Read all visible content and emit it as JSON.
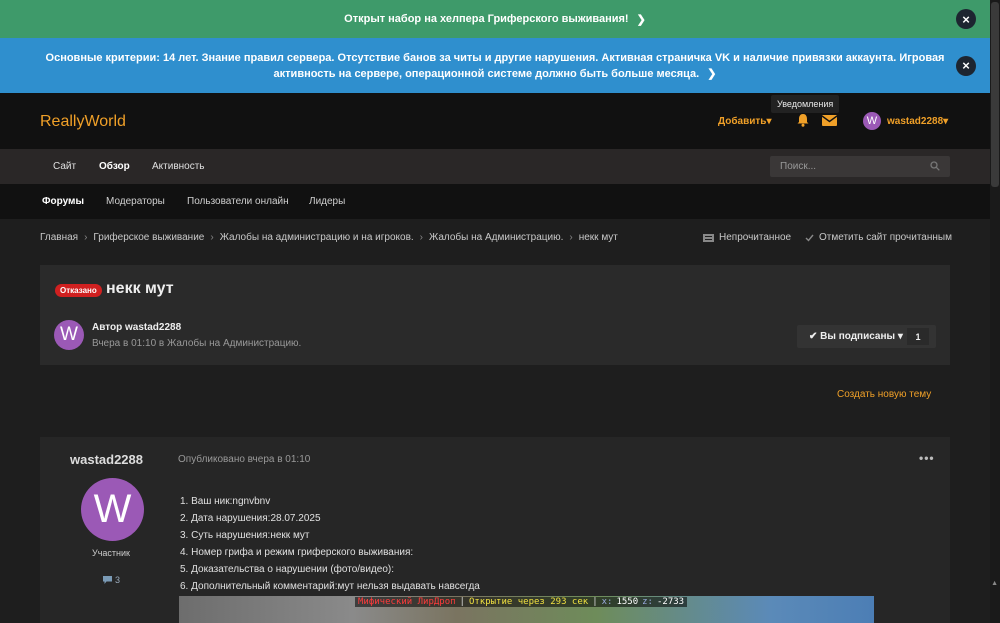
{
  "banners": {
    "green_text": "Открыт набор на хелпера Гриферского выживания!",
    "blue_text": "Основные критерии: 14 лет. Знание правил сервера. Отсутствие банов за читы и другие нарушения. Активная страничка VK и наличие привязки аккаунта. Игровая активность на сервере, операционной системе должно быть больше месяца.",
    "close": "×",
    "chevron": "❯",
    "green_color": "#3e9a6a",
    "blue_color": "#2f8fce"
  },
  "header": {
    "logo": "ReallyWorld",
    "add": "Добавить",
    "caret": "▾",
    "tooltip": "Уведомления",
    "user_initial": "W",
    "username": "wastad2288",
    "accent": "#f0a028"
  },
  "nav": {
    "primary": [
      "Сайт",
      "Обзор",
      "Активность"
    ],
    "search_placeholder": "Поиск...",
    "secondary": [
      "Форумы",
      "Модераторы",
      "Пользователи онлайн",
      "Лидеры"
    ]
  },
  "breadcrumb": {
    "items": [
      "Главная",
      "Гриферское выживание",
      "Жалобы на администрацию и на игроков.",
      "Жалобы на Администрацию.",
      "некк мут"
    ],
    "sep": "›",
    "unread": "Непрочитанное",
    "mark_read": "Отметить сайт прочитанным"
  },
  "topic": {
    "badge": "Отказано",
    "title": "некк мут",
    "avatar_initial": "W",
    "author": "Автор wastad2288",
    "meta": "Вчера в 01:10 в Жалобы на Администрацию.",
    "follow": "✔ Вы подписаны",
    "follow_caret": "▾",
    "follow_count": "1",
    "new_topic": "Создать новую тему"
  },
  "post": {
    "author": "wastad2288",
    "published": "Опубликовано вчера в 01:10",
    "dots": "•••",
    "avatar_initial": "W",
    "role": "Участник",
    "comments_count": "3",
    "lines": [
      "1. Ваш ник:ngnvbnv",
      "2. Дата нарушения:28.07.2025",
      "3. Суть нарушения:некк мут",
      "4. Номер грифа и режим гриферского выживания:",
      "5. Доказательства о нарушении (фото/видео):",
      "6. Дополнительный комментарий:мут нельзя выдавать навсегда"
    ],
    "hud": {
      "event": "Мифический ЛирДроп",
      "timer": "Открытие через 293 сек",
      "x": "1550",
      "z": "-2733",
      "sep1": "|",
      "sep2": "|",
      "x_label": "x:",
      "z_label": "z:"
    }
  },
  "scroll_arrow": "▲"
}
